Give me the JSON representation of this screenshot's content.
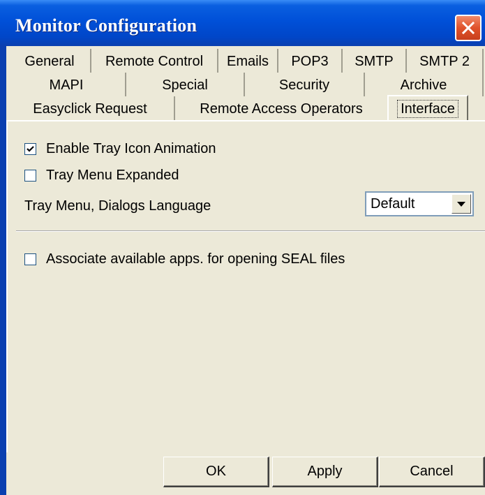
{
  "window": {
    "title": "Monitor Configuration"
  },
  "tabs": {
    "row1": [
      "General",
      "Remote Control",
      "Emails",
      "POP3",
      "SMTP",
      "SMTP 2"
    ],
    "row2": [
      "MAPI",
      "Special",
      "Security",
      "Archive"
    ],
    "row3": [
      "Easyclick Request",
      "Remote Access Operators",
      "Interface"
    ],
    "active": "Interface"
  },
  "panel": {
    "enable_tray_icon_animation": {
      "label": "Enable Tray Icon Animation",
      "checked": true
    },
    "tray_menu_expanded": {
      "label": "Tray Menu Expanded",
      "checked": false
    },
    "language": {
      "label": "Tray Menu, Dialogs Language",
      "value": "Default"
    },
    "associate_apps": {
      "label": "Associate available apps. for opening SEAL files",
      "checked": false
    }
  },
  "buttons": {
    "ok": "OK",
    "apply": "Apply",
    "cancel": "Cancel"
  },
  "icons": {
    "close": "close-icon",
    "check": "check-icon",
    "dropdown": "chevron-down-icon"
  },
  "colors": {
    "titlebar": "#0050d8",
    "close_button": "#e0522a",
    "window_background": "#ece9d8"
  }
}
